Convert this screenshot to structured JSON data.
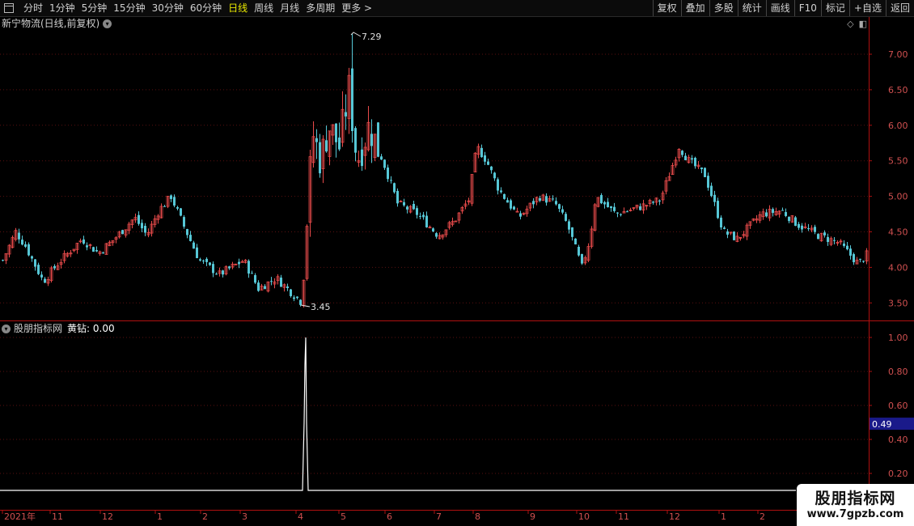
{
  "toolbar": {
    "periods": [
      "分时",
      "1分钟",
      "5分钟",
      "15分钟",
      "30分钟",
      "60分钟",
      "日线",
      "周线",
      "月线",
      "多周期",
      "更多 >"
    ],
    "active_period": "日线",
    "buttons": [
      "复权",
      "叠加",
      "多股",
      "统计",
      "画线",
      "F10",
      "标记",
      "+自选",
      "返回"
    ]
  },
  "main_chart": {
    "title": "新宁物流(日线,前复权)",
    "high_label": "7.29",
    "low_label": "3.45",
    "y_ticks": [
      "7.00",
      "6.50",
      "6.00",
      "5.50",
      "5.00",
      "4.50",
      "4.00",
      "3.50"
    ]
  },
  "indicator": {
    "name": "股朋指标网",
    "series_label": "黄钻: 0.00",
    "y_ticks": [
      "1.00",
      "0.80",
      "0.60",
      "0.40",
      "0.20"
    ],
    "current_value": "0.49"
  },
  "x_axis": {
    "labels": [
      "2021年",
      "11",
      "12",
      "1",
      "2",
      "3",
      "4",
      "5",
      "6",
      "7",
      "8",
      "9",
      "10",
      "11",
      "12",
      "1",
      "2"
    ]
  },
  "watermark": {
    "line1": "股朋指标网",
    "line2": "www.7gpzb.com"
  },
  "colors": {
    "up": "#e84a4a",
    "down": "#56c7d6",
    "accent": "#e8e800",
    "frame": "#b01010"
  },
  "chart_data": {
    "type": "candlestick",
    "price_range": [
      3.3,
      7.5
    ],
    "indicator_range": [
      0.1,
      1.05
    ],
    "highest": 7.29,
    "lowest": 3.45,
    "indicator_spike": {
      "near": "4",
      "peak": 1.0
    }
  }
}
